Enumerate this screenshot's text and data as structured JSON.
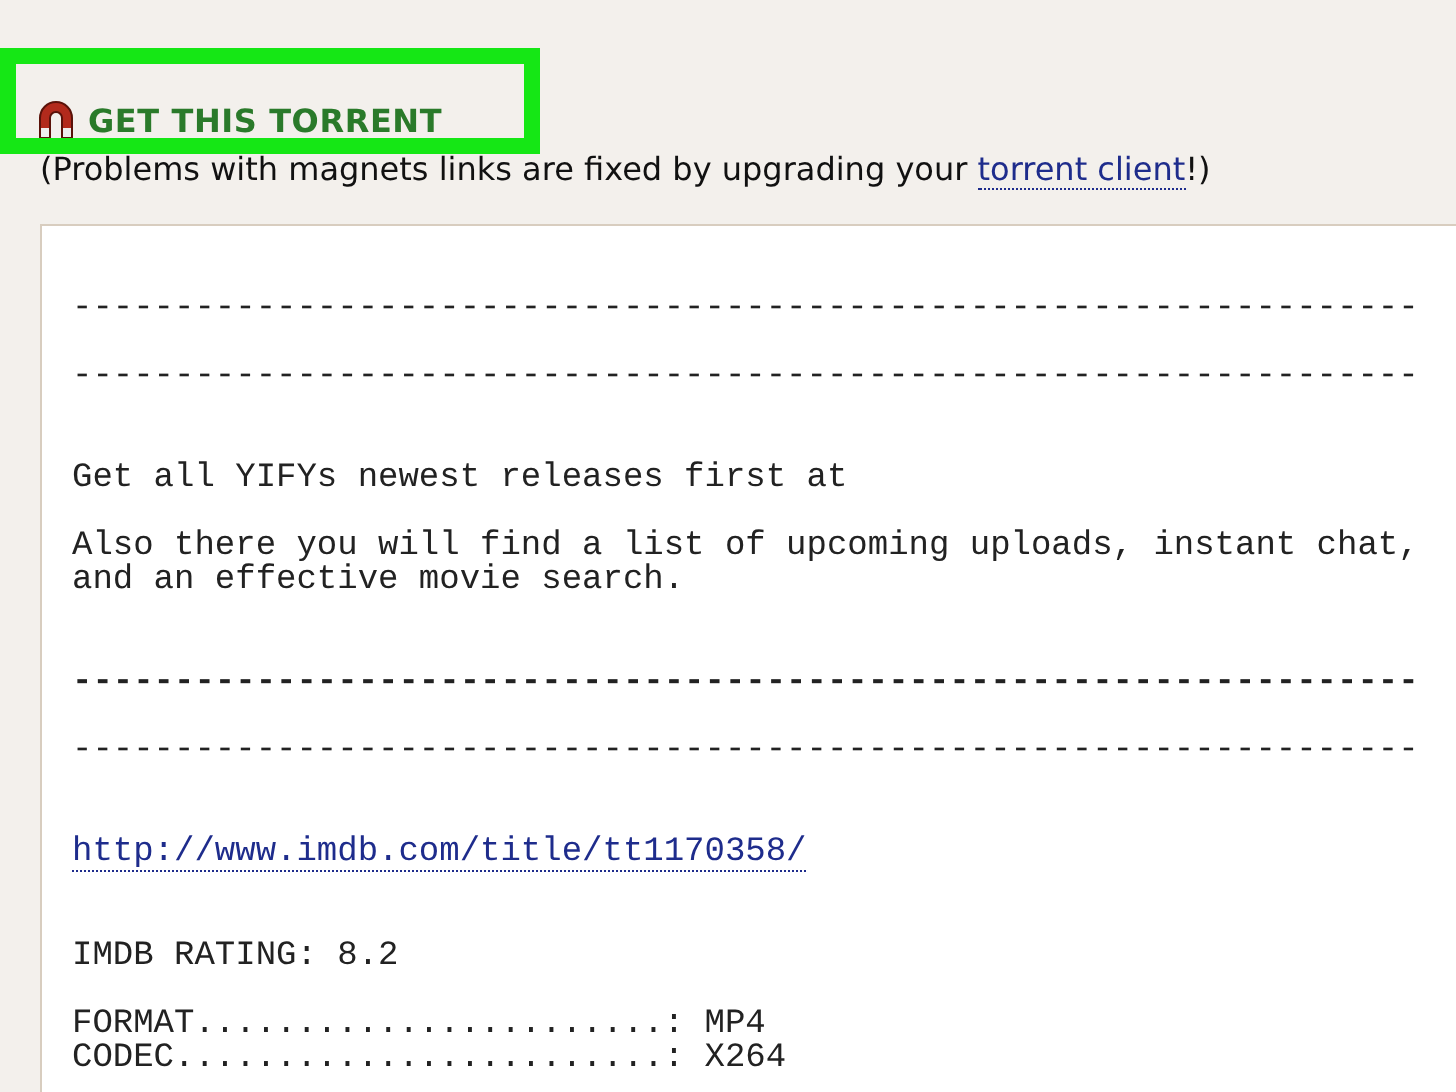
{
  "download": {
    "label": "GET THIS TORRENT",
    "highlighted": true
  },
  "notice": {
    "before": "(Problems with magnets links are fixed by upgrading your ",
    "link": "torrent client",
    "after": "!)"
  },
  "description": [
    {
      "kind": "rule",
      "lines": [
        "------------------------------------------------------------------"
      ]
    },
    {
      "kind": "rule",
      "lines": [
        "------------------------------------------------------------------"
      ]
    },
    {
      "kind": "text",
      "lines": [
        "Get all YIFYs newest releases first at"
      ]
    },
    {
      "kind": "text",
      "lines": [
        "Also there you will find a list of upcoming uploads, instant chat,",
        "and an effective movie search."
      ]
    },
    {
      "kind": "bold-rule",
      "lines": [
        "------------------------------------------------------------------"
      ]
    },
    {
      "kind": "rule",
      "lines": [
        "------------------------------------------------------------------"
      ]
    },
    {
      "kind": "link",
      "lines": [
        "http://www.imdb.com/title/tt1170358/"
      ]
    },
    {
      "kind": "text",
      "lines": [
        "IMDB RATING: 8.2"
      ]
    },
    {
      "kind": "text",
      "lines": [
        "FORMAT.......................: MP4",
        "CODEC........................: X264"
      ]
    }
  ]
}
